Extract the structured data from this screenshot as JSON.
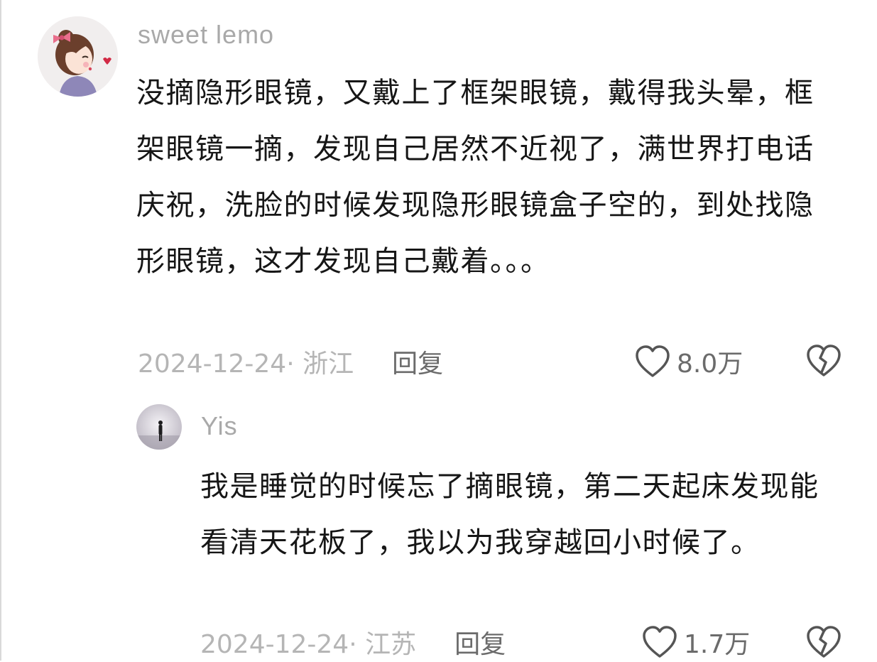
{
  "comments": [
    {
      "username": "sweet lemo",
      "avatar_icon": "cartoon-girl-avatar-icon",
      "text": "没摘隐形眼镜，又戴上了框架眼镜，戴得我头晕，框架眼镜一摘，发现自己居然不近视了，满世界打电话庆祝，洗脸的时候发现隐形眼镜盒子空的，到处找隐形眼镜，这才发现自己戴着。。。",
      "date_location": "2024-12-24· 浙江",
      "reply_label": "回复",
      "like_count": "8.0万",
      "like_icon": "heart-outline-icon",
      "dislike_icon": "broken-heart-icon"
    },
    {
      "username": "Yis",
      "avatar_icon": "silhouette-photo-avatar-icon",
      "text": "我是睡觉的时候忘了摘眼镜，第二天起床发现能看清天花板了，我以为我穿越回小时候了。",
      "date_location": "2024-12-24· 江苏",
      "reply_label": "回复",
      "like_count": "1.7万",
      "like_icon": "heart-outline-icon",
      "dislike_icon": "broken-heart-icon"
    }
  ],
  "colors": {
    "username": "#a9a9a9",
    "body_text": "#161616",
    "meta_text": "#b5b5b5",
    "action_text": "#6b6b6b"
  }
}
